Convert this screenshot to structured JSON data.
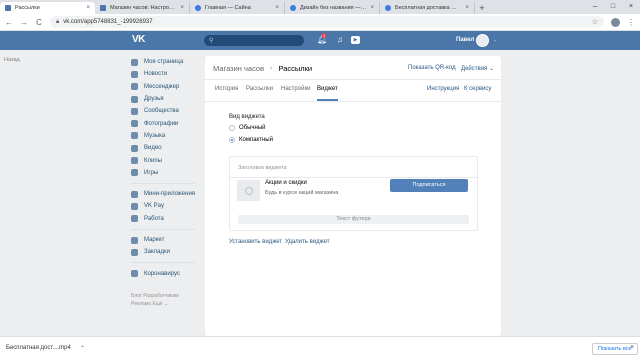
{
  "browser": {
    "tabs": [
      {
        "title": "Рассылки",
        "favicon_color": "#4a76a8",
        "active": true
      },
      {
        "title": "Магазин часов: Настройки",
        "favicon_color": "#4a76a8",
        "active": false
      },
      {
        "title": "Главная — Сайна",
        "favicon_color": "#3c7be0",
        "active": false
      },
      {
        "title": "Дизайн без названия — Лого...",
        "favicon_color": "#3c7be0",
        "active": false
      },
      {
        "title": "Бесплатная доставка — 1080 ...",
        "favicon_color": "#3c7be0",
        "active": false
      }
    ],
    "new_tab": "+",
    "window_controls": [
      "–",
      "□",
      "×"
    ],
    "url": "vk.com/app5748831_-199926937",
    "nav": {
      "back": "←",
      "forward": "→",
      "reload": "C"
    }
  },
  "vk_header": {
    "logo": "VK",
    "notifications_count": "3",
    "username": "Павел"
  },
  "back_link": "Назад",
  "sidebar": {
    "group1": [
      "Моя страница",
      "Новости",
      "Мессенджер",
      "Друзья",
      "Сообщества",
      "Фотографии",
      "Музыка",
      "Видео",
      "Клипы",
      "Игры"
    ],
    "group2": [
      "Мини-приложения",
      "VK Pay",
      "Работа"
    ],
    "group3": [
      "Маркет",
      "Закладки"
    ],
    "group4": [
      "Коронавирус"
    ],
    "footer": {
      "line1": "Блог   Разработчикам",
      "line2": "Реклама   Ещё ⌄"
    }
  },
  "panel": {
    "breadcrumb": {
      "parent": "Магазин часов",
      "current": "Рассылки"
    },
    "show_qr": "Показать QR-код",
    "actions": "Действия ⌄",
    "tabs": [
      "История",
      "Рассылки",
      "Настройки",
      "Виджет"
    ],
    "selected_tab": "Виджет",
    "right_links": {
      "instruction": "Инструкция",
      "to_service": "К сервису"
    },
    "widget_type_label": "Вид виджета",
    "options": [
      {
        "label": "Обычный",
        "checked": false
      },
      {
        "label": "Компактный",
        "checked": true
      }
    ],
    "widget": {
      "header_placeholder": "Заголовок виджета",
      "name": "Акции и скидки",
      "description": "Будь в курсе акций магазина",
      "subscribe_button": "Подписаться",
      "footer_placeholder": "Текст футера"
    },
    "install_link": "Установить виджет",
    "delete_link": "Удалить виджет"
  },
  "download_bar": {
    "item": "Бесплатная дост....mp4",
    "show_all": "Показать все",
    "close": "×"
  },
  "colors": {
    "vk_blue": "#4a76a8",
    "button_blue": "#5181b8",
    "link_blue": "#2a5885"
  }
}
